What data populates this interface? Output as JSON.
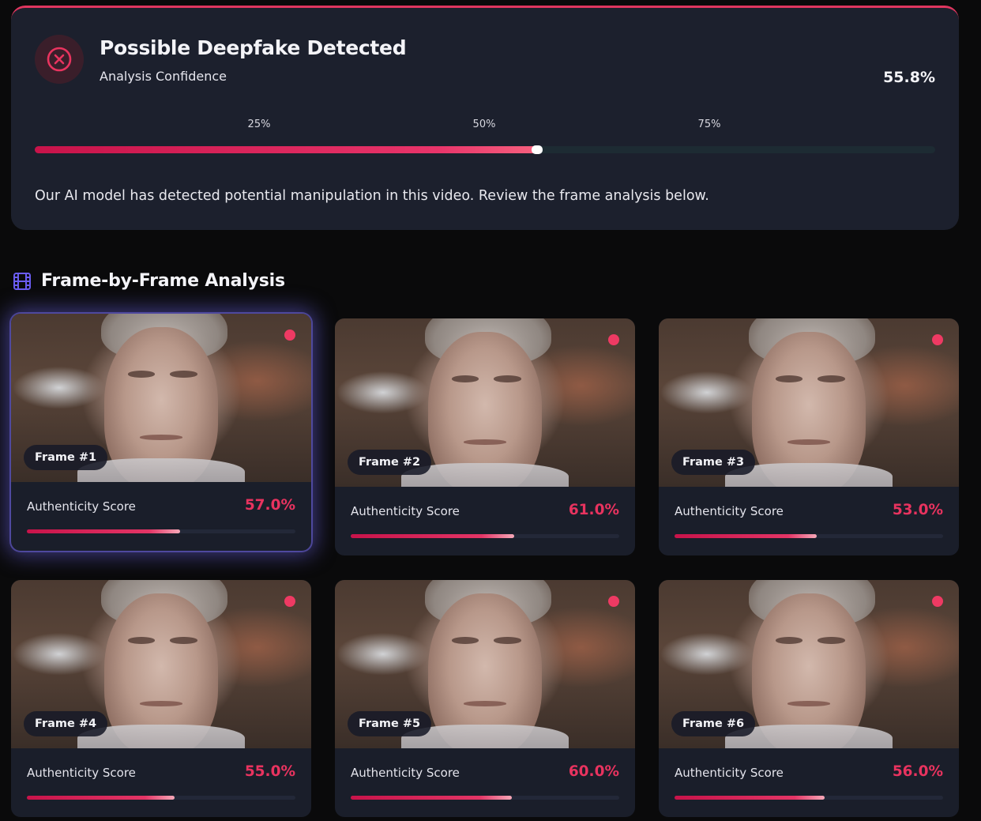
{
  "result": {
    "title": "Possible Deepfake Detected",
    "subtitle": "Analysis Confidence",
    "confidence_text": "55.8%",
    "confidence_fraction": 0.558,
    "ticks": [
      "25%",
      "50%",
      "75%"
    ],
    "message": "Our AI model has detected potential manipulation in this video. Review the frame analysis below.",
    "status_icon": "x-circle-icon",
    "accent_color": "#e0365f"
  },
  "section": {
    "title": "Frame-by-Frame Analysis",
    "icon": "film-icon",
    "icon_color": "#6a5cf0"
  },
  "frames": [
    {
      "label": "Frame #1",
      "score_label": "Authenticity Score",
      "score_text": "57.0%",
      "score": 0.57,
      "selected": true
    },
    {
      "label": "Frame #2",
      "score_label": "Authenticity Score",
      "score_text": "61.0%",
      "score": 0.61
    },
    {
      "label": "Frame #3",
      "score_label": "Authenticity Score",
      "score_text": "53.0%",
      "score": 0.53
    },
    {
      "label": "Frame #4",
      "score_label": "Authenticity Score",
      "score_text": "55.0%",
      "score": 0.55
    },
    {
      "label": "Frame #5",
      "score_label": "Authenticity Score",
      "score_text": "60.0%",
      "score": 0.6
    },
    {
      "label": "Frame #6",
      "score_label": "Authenticity Score",
      "score_text": "56.0%",
      "score": 0.56
    }
  ]
}
